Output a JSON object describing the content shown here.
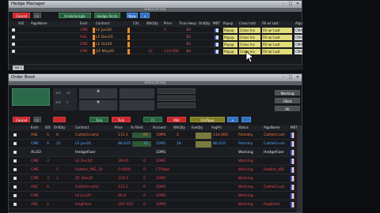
{
  "hedge": {
    "title": "Hedge Manager",
    "sim": "SIMULATION",
    "toolbar": {
      "cancel": "Cancel",
      "clr": "Clr",
      "dd1": "Underlyingle",
      "dd2": "Hedge Accts",
      "new": "New",
      "plus": "+"
    },
    "headers": [
      "A/O",
      "AlgoName",
      "Exch",
      "Contract",
      "CXL",
      "WrkQty",
      "Price",
      "Ticks Away",
      "OrdQty",
      "MBT",
      "Payup",
      "Cross Instr",
      "Fill w/ Last",
      "Algo"
    ],
    "rows": [
      {
        "alg": "",
        "exch": "CME",
        "contract": "LE Jun20",
        "cxl": "",
        "wrk": "",
        "price": "0",
        "ticks": "10",
        "ord": "",
        "payup": "Payup",
        "cross": "Cross Ins",
        "fill": "Fill w/ Last",
        "algo": "CMA"
      },
      {
        "alg": "",
        "exch": "ASE",
        "contract": "LE Dec20",
        "cxl": "",
        "wrk": "",
        "price": "",
        "ticks": "10",
        "ord": "",
        "payup": "Payup",
        "cross": "Cross Ins",
        "fill": "Fill w/ Last",
        "algo": "CMA"
      },
      {
        "alg": "",
        "exch": "CME",
        "contract": "LE Oct20",
        "cxl": "",
        "wrk": "",
        "price": "",
        "ticks": "10",
        "ord": "",
        "payup": "Payup",
        "cross": "Cross Ins",
        "fill": "Fill w/ Last",
        "algo": "CMA"
      },
      {
        "alg": "",
        "exch": "CME",
        "contract": "GF May20",
        "cxl": "",
        "wrk": "12",
        "price": "110.000",
        "ticks": "10",
        "ord": "",
        "payup": "Payup",
        "cross": "Cross Ins",
        "fill": "Fill w/ Last",
        "algo": "CMA"
      }
    ],
    "tab": "Tab 1"
  },
  "order": {
    "title": "Order Book",
    "sim": "SIMULATION",
    "qty": [
      "100",
      "10",
      "500",
      "5"
    ],
    "side": {
      "working": "Working",
      "filled": "Filled",
      "all": "All"
    },
    "toolbar": {
      "cancel": "Cancel",
      "clr": "Clr",
      "a": "Tick",
      "b": "Tick",
      "c": "Fl",
      "d": "Mkt",
      "e": "OrdType",
      "plus": "+"
    },
    "headers": [
      "Exch",
      "B/S",
      "OrdQty",
      "Contract",
      "Price",
      "% Filled",
      "Account",
      "WrkQty",
      "ExeQty",
      "AvgPrc",
      "Status",
      "AlgoName",
      "MBT"
    ],
    "rows": [
      {
        "exch": "ASE",
        "bs": "S",
        "oq": "6",
        "ct": "CattleCrush2",
        "pr": "112.1",
        "pf": "60",
        "ac": "10M1",
        "wq": "2",
        "eq": "",
        "ap": "114.004",
        "st": "Partially",
        "an": "CattleCrush",
        "kind": "orange"
      },
      {
        "exch": "CME",
        "bs": "S",
        "oq": "21",
        "ct": "LE Jun20",
        "pr": "86.625",
        "pf": "14",
        "ac": "10M1",
        "wq": "18",
        "eq": "",
        "ap": "86.625",
        "st": "Partially",
        "an": "CattleCrush",
        "kind": "blue"
      },
      {
        "exch": "ALGO",
        "bs": "",
        "oq": "",
        "ct": "HedgeFixer",
        "pr": "",
        "pf": "",
        "ac": "10M1",
        "wq": "",
        "eq": "",
        "ap": "",
        "st": "Working",
        "an": "HedgeFixer",
        "kind": "white"
      },
      {
        "exch": "CME",
        "bs": "3",
        "oq": "",
        "ct": "LE Dec20",
        "pr": "393.0",
        "pf": "0",
        "ac": "10M1",
        "wq": "",
        "eq": "",
        "ap": "",
        "st": "Working",
        "an": "",
        "kind": "red"
      },
      {
        "exch": "CME",
        "bs": "",
        "oq": "5",
        "ct": "Rubber_INE_10",
        "pr": "0.0000",
        "pf": "0",
        "ac": "CTAlgor",
        "wq": "",
        "eq": "",
        "ap": "",
        "st": "Working",
        "an": "Rubber_INE",
        "kind": "red"
      },
      {
        "exch": "CME",
        "bs": "3",
        "oq": "1",
        "ct": "ZC Dec20",
        "pr": "319.5",
        "pf": "0",
        "ac": "10M1",
        "wq": "",
        "eq": "",
        "ap": "",
        "st": "Working",
        "an": "",
        "kind": "red"
      },
      {
        "exch": "ASE",
        "bs": "S",
        "oq": "",
        "ct": "CattleCrush2",
        "pr": "112.2",
        "pf": "0",
        "ac": "10M1",
        "wq": "",
        "eq": "",
        "ap": "",
        "st": "Working",
        "an": "CattleCrush",
        "kind": "red"
      },
      {
        "exch": "CME",
        "bs": "",
        "oq": "",
        "ct": "LE Jun20",
        "pr": "80.6",
        "pf": "0",
        "ac": "10M1",
        "wq": "",
        "eq": "",
        "ap": "",
        "st": "Working",
        "an": "",
        "kind": "red"
      },
      {
        "exch": "ASE",
        "bs": "2",
        "oq": "",
        "ct": "HogFeed",
        "pr": "205.525",
        "pf": "0",
        "ac": "10M1",
        "wq": "",
        "eq": "",
        "ap": "",
        "st": "Working",
        "an": "HogFeed",
        "kind": "red"
      }
    ]
  }
}
